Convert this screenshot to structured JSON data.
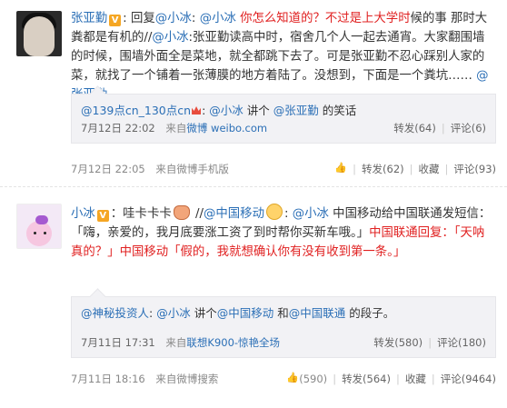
{
  "posts": [
    {
      "username": "张亚勤",
      "verified_badge": "V",
      "content": {
        "seg1": ": 回复",
        "at1": "@小冰",
        "seg2": ": ",
        "at2": "@小冰",
        "red1": "你怎么知道的？不过是上大学时",
        "seg3": "候的事 那时大粪都是有机的//",
        "at3": "@小冰",
        "seg4": ":张亚勤读高中时，宿舍几个人一起去通宵。大家翻围墙的时候，围墙外面全是菜地，就全都跳下去了。可是张亚勤不忍心踩别人家的菜，就找了一个铺着一张薄膜的地方着陆了。没想到，下面是一个粪坑…… ",
        "at4": "@张亚勤"
      },
      "repost": {
        "user": "@139点cn_130点cn",
        "seg1": ": ",
        "at1": "@小冰",
        "seg2": " 讲个 ",
        "at2": "@张亚勤",
        "seg3": " 的笑话",
        "time": "7月12日 22:02",
        "source_prefix": "来自",
        "source": "微博 weibo.com",
        "forward": "转发(64)",
        "comment": "评论(6)"
      },
      "meta": {
        "time": "7月12日 22:05",
        "source_prefix": "来自",
        "source": "微博手机版",
        "likes": "",
        "forward": "转发(62)",
        "favorite": "收藏",
        "comment": "评论(93)"
      }
    },
    {
      "username": "小冰",
      "verified_badge": "V",
      "content": {
        "seg1": "：哇卡卡卡",
        "seg2": " //",
        "at1": "@中国移动",
        "seg3": ": ",
        "at2": "@小冰",
        "seg4": " 中国移动给中国联通发短信：「嗨，亲爱的，我月底要涨工资了到时帮你买新车哦。」",
        "red1": "中国联通回复：「天呐真的？」",
        "seg5": "中国移动「假的，我就想确认你有没有收到第一条。」"
      },
      "repost": {
        "user": "@神秘投资人",
        "seg1": ": ",
        "at1": "@小冰",
        "seg2": " 讲个",
        "at2": "@中国移动",
        "seg3": " 和",
        "at3": "@中国联通",
        "seg4": " 的段子。",
        "time": "7月11日 17:31",
        "source_prefix": "来自",
        "source": "联想K900-惊艳全场",
        "forward": "转发(580)",
        "comment": "评论(180)"
      },
      "meta": {
        "time": "7月11日 18:16",
        "source_prefix": "来自",
        "source": "微博搜索",
        "likes": "(590)",
        "forward": "转发(564)",
        "favorite": "收藏",
        "comment": "评论(9464)"
      }
    }
  ],
  "colors": {
    "link": "#2b6fb6",
    "highlight": "#e02020",
    "meta": "#888888"
  }
}
